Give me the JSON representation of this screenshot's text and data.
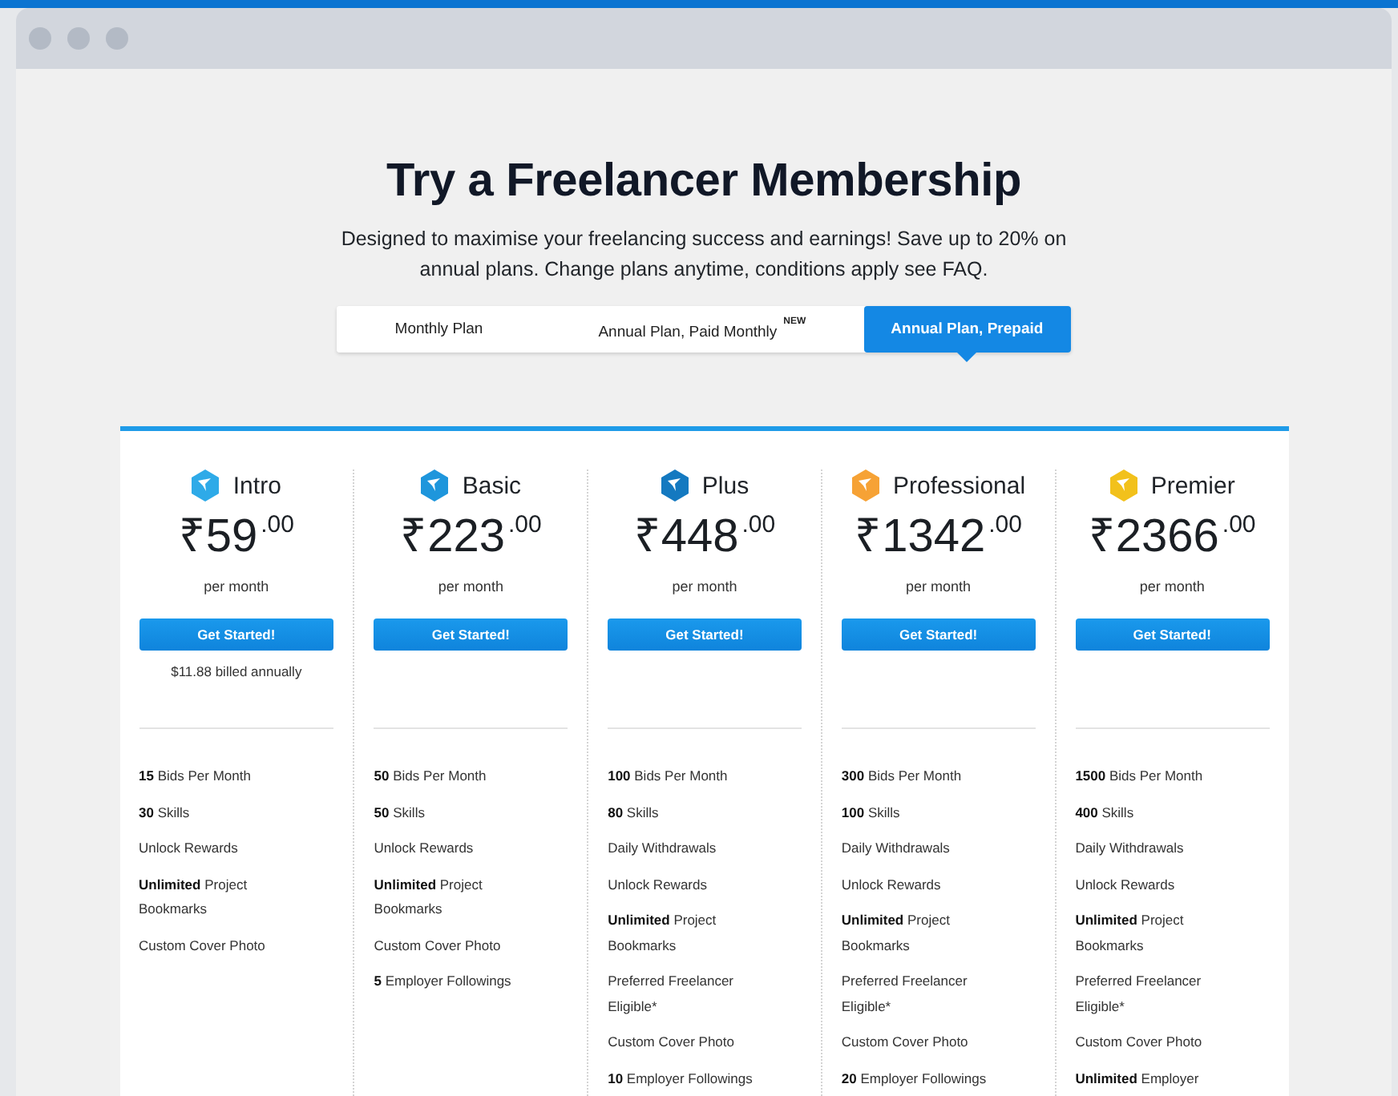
{
  "title": "Try a Freelancer Membership",
  "subtitle": "Designed to maximise your freelancing success and earnings! Save up to 20% on annual plans. Change plans anytime, conditions apply see FAQ.",
  "tabs": [
    {
      "label": "Monthly Plan",
      "selected": false
    },
    {
      "label": "Annual Plan, Paid Monthly",
      "badge": "NEW",
      "selected": false
    },
    {
      "label": "Annual Plan, Prepaid",
      "selected": true
    }
  ],
  "plans": [
    {
      "name": "Intro",
      "color": "#2eaae8",
      "price": "₹59",
      "cents": ".00",
      "period": "per month",
      "button": "Get Started!",
      "note": "$11.88 billed annually",
      "features": [
        "**15** Bids Per Month",
        "**30** Skills",
        "Unlock Rewards",
        "**Unlimited** Project Bookmarks",
        "Custom Cover Photo"
      ]
    },
    {
      "name": "Basic",
      "color": "#1e96dc",
      "price": "₹223",
      "cents": ".00",
      "period": "per month",
      "button": "Get Started!",
      "features": [
        "**50** Bids Per Month",
        "**50** Skills",
        "Unlock Rewards",
        "**Unlimited** Project Bookmarks",
        "Custom Cover Photo",
        "**5** Employer Followings"
      ]
    },
    {
      "name": "Plus",
      "color": "#1479c0",
      "price": "₹448",
      "cents": ".00",
      "period": "per month",
      "button": "Get Started!",
      "features": [
        "**100** Bids Per Month",
        "**80** Skills",
        "Daily Withdrawals",
        "Unlock Rewards",
        "**Unlimited** Project Bookmarks",
        "Preferred Freelancer Eligible*",
        "Custom Cover Photo",
        "**10** Employer Followings"
      ]
    },
    {
      "name": "Professional",
      "color": "#f6a235",
      "price": "₹1342",
      "cents": ".00",
      "period": "per month",
      "button": "Get Started!",
      "features": [
        "**300** Bids Per Month",
        "**100** Skills",
        "Daily Withdrawals",
        "Unlock Rewards",
        "**Unlimited** Project Bookmarks",
        "Preferred Freelancer Eligible*",
        "Custom Cover Photo",
        "**20** Employer Followings"
      ]
    },
    {
      "name": "Premier",
      "color": "#f2c11b",
      "price": "₹2366",
      "cents": ".00",
      "period": "per month",
      "button": "Get Started!",
      "features": [
        "**1500** Bids Per Month",
        "**400** Skills",
        "Daily Withdrawals",
        "Unlock Rewards",
        "**Unlimited** Project Bookmarks",
        "Preferred Freelancer Eligible*",
        "Custom Cover Photo",
        "**Unlimited** Employer"
      ]
    }
  ]
}
